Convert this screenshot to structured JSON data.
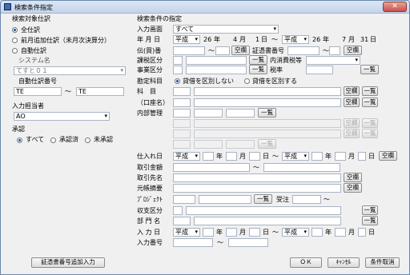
{
  "window": {
    "title": "検索条件指定",
    "close": "✕"
  },
  "left": {
    "target_title": "検索対象仕訳",
    "r_all": "全仕訳",
    "r_period": "前月追加仕訳（未月次決算分）",
    "r_auto": "自動仕訳",
    "system_label": "システム名",
    "system_value": "てすと０１",
    "auto_no_label": "自動仕訳番号",
    "te1": "TE",
    "tilde": "～",
    "te2": "TE",
    "input_person_label": "入力担当者",
    "input_person_value": "AO",
    "approval_label": "承認",
    "ap_all": "すべて",
    "ap_done": "承認済",
    "ap_not": "未承認",
    "add_button": "証憑書番号追加入力"
  },
  "right": {
    "cond_title": "検索条件の指定",
    "screen_label": "入力画面",
    "screen_value": "すべて",
    "date_label": "年 月 日",
    "era1": "平成",
    "y1": "26",
    "nen": "年",
    "m1": "4",
    "tsuki": "月",
    "d1": "1",
    "hi": "日",
    "tilde": "～",
    "era2": "平成",
    "y2": "26",
    "m2": "7",
    "d2": "31",
    "denpyo_label": "伝(買)番",
    "shoken_label": "証憑書番号",
    "kazei_label": "課税区分",
    "uchi_label": "内消費税等",
    "jigyo_label": "事業区分",
    "zeiritsu_label": "税率",
    "kanjo_label": "勘定科目",
    "r_no_split": "貸借を区別しない",
    "r_split": "貸借を区別する",
    "kamoku_label": "科　目",
    "koza_label": "（口座名）",
    "naibu_label": "内部管理",
    "shiire_label": "仕入れ日",
    "torihiki_kin_label": "取引金額",
    "torihiki_saki_label": "取引先名",
    "genpyo_label": "元帳摘要",
    "project_label": "ﾌﾟﾛｼﾞｪｸﾄ",
    "jyuchu_label": "受注",
    "shushi_label": "収支区分",
    "bumon_label": "部 門 名",
    "nyuryoku_date_label": "入 力 日",
    "nyuryoku_no_label": "入力番号",
    "btn_empty": "空欄",
    "btn_list": "一覧",
    "btn_ok": "ＯＫ",
    "btn_cancel": "ｷｬﾝｾﾙ",
    "btn_clear": "条件取消"
  }
}
